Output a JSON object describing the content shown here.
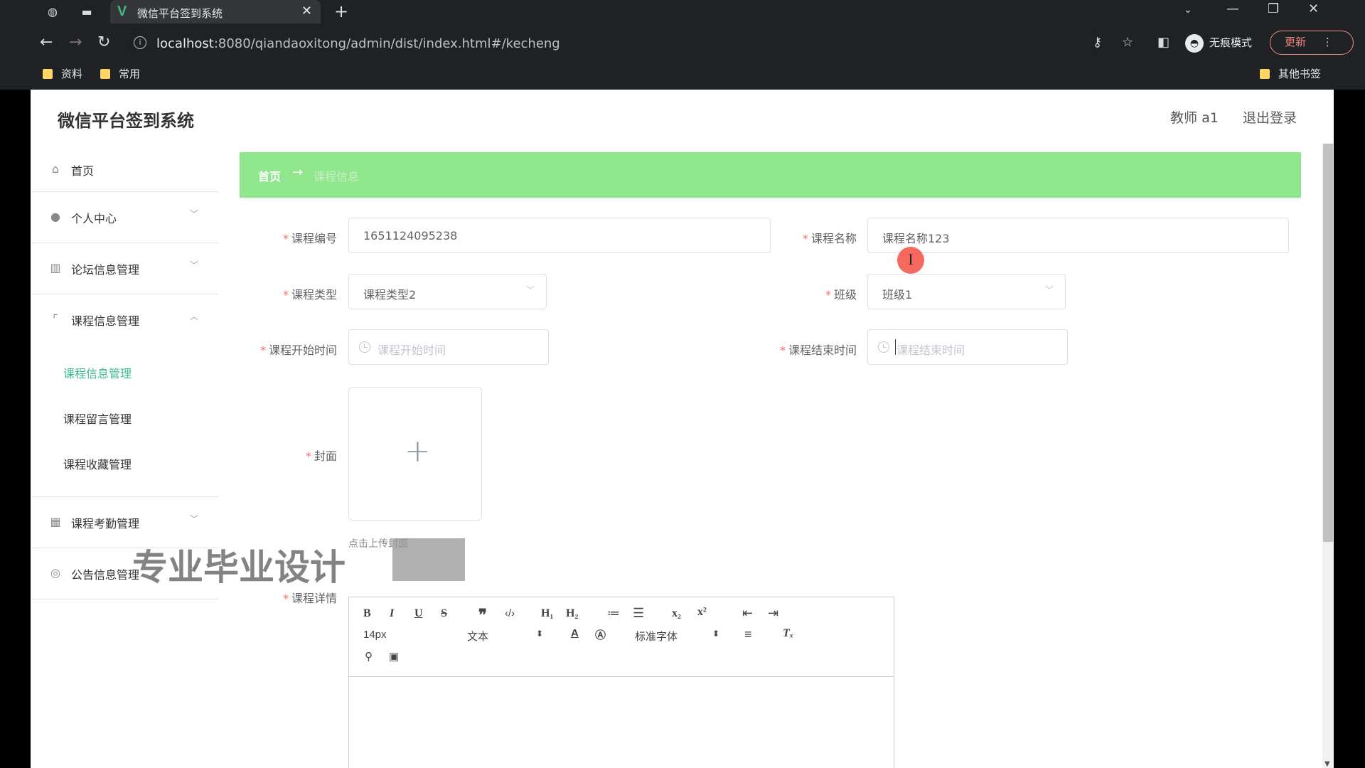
{
  "browser": {
    "tab_title": "微信平台签到系统",
    "tab_favicon": "V",
    "url_host": "localhost",
    "url_rest": ":8080/qiandaoxitong/admin/dist/index.html#/kecheng",
    "incognito_label": "无痕模式",
    "update_label": "更新",
    "bookmarks": [
      "资料",
      "常用"
    ],
    "other_bookmarks": "其他书签"
  },
  "app": {
    "title": "微信平台签到系统",
    "user": "教师 a1",
    "logout": "退出登录"
  },
  "sidebar": {
    "items": [
      {
        "label": "首页",
        "icon": "home-icon"
      },
      {
        "label": "个人中心",
        "icon": "user-icon"
      },
      {
        "label": "论坛信息管理",
        "icon": "chart-icon"
      },
      {
        "label": "课程信息管理",
        "icon": "crop-icon"
      },
      {
        "label": "课程考勤管理",
        "icon": "grid-icon"
      },
      {
        "label": "公告信息管理",
        "icon": "globe-icon"
      }
    ],
    "submenu": [
      "课程信息管理",
      "课程留言管理",
      "课程收藏管理"
    ]
  },
  "breadcrumb": {
    "home": "首页",
    "separator": "→",
    "current": "课程信息"
  },
  "form": {
    "course_no": {
      "label": "课程编号",
      "value": "1651124095238"
    },
    "course_name": {
      "label": "课程名称",
      "value": "课程名称123"
    },
    "course_type": {
      "label": "课程类型",
      "value": "课程类型2"
    },
    "class": {
      "label": "班级",
      "value": "班级1"
    },
    "start_time": {
      "label": "课程开始时间",
      "placeholder": "课程开始时间"
    },
    "end_time": {
      "label": "课程结束时间",
      "placeholder": "课程结束时间"
    },
    "cover": {
      "label": "封面",
      "tip": "点击上传封面"
    },
    "detail": {
      "label": "课程详情"
    }
  },
  "editor": {
    "font_size": "14px",
    "text_type": "文本",
    "font_family": "标准字体"
  },
  "watermark": "专业毕业设计"
}
